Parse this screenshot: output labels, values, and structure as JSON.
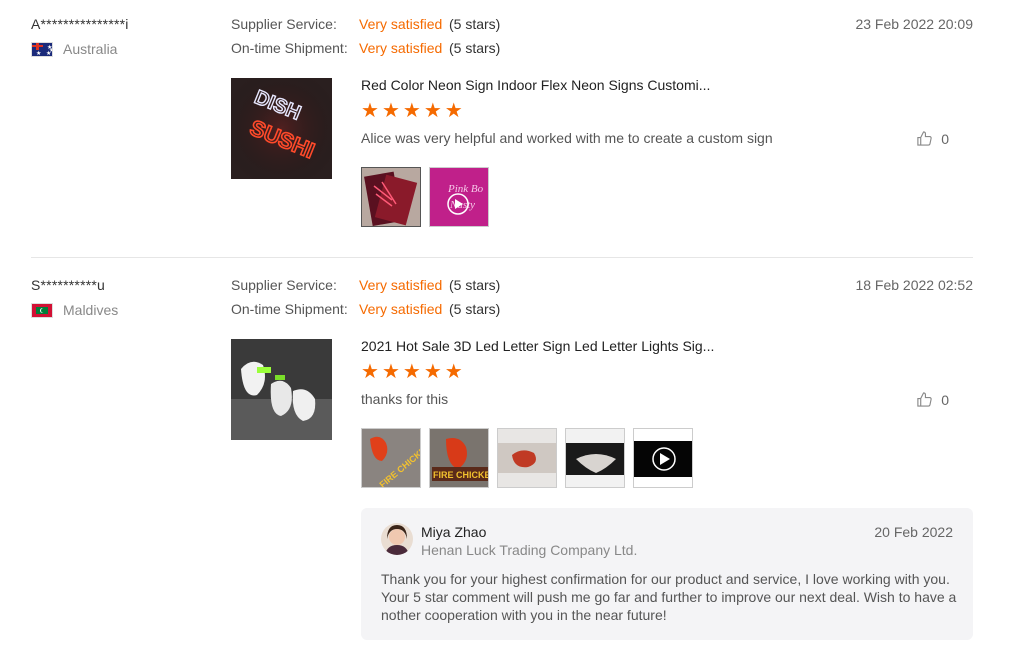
{
  "reviews": [
    {
      "buyer": "A***************i",
      "country": "Australia",
      "ratings": [
        {
          "label": "Supplier Service:",
          "value": "Very satisfied",
          "stars": "(5 stars)"
        },
        {
          "label": "On-time Shipment:",
          "value": "Very satisfied",
          "stars": "(5 stars)"
        }
      ],
      "date": "23 Feb 2022 20:09",
      "product_title": "Red Color Neon Sign Indoor Flex Neon Signs Customi...",
      "product_stars": 5,
      "comment": "Alice was very helpful and worked with me to create a custom sign",
      "likes": "0",
      "product_image_text": [
        "DISH",
        "SUSHI"
      ],
      "thumb2_text": [
        "Pink Bo",
        "Nasty"
      ]
    },
    {
      "buyer": "S**********u",
      "country": "Maldives",
      "ratings": [
        {
          "label": "Supplier Service:",
          "value": "Very satisfied",
          "stars": "(5 stars)"
        },
        {
          "label": "On-time Shipment:",
          "value": "Very satisfied",
          "stars": "(5 stars)"
        }
      ],
      "date": "18 Feb 2022 02:52",
      "product_title": "2021 Hot Sale 3D Led Letter Sign Led Letter Lights Sig...",
      "product_stars": 5,
      "comment": "thanks for this",
      "likes": "0",
      "thumb_text": [
        "FIRE CHICKEN",
        "FIRE CHICKEN"
      ],
      "reply": {
        "name": "Miya Zhao",
        "company": "Henan Luck Trading Company Ltd.",
        "date": "20 Feb 2022",
        "text": "Thank you for your highest confirmation for our product and service, I love working with you. Your 5 star comment will push me go far and further to improve our next deal. Wish to have another cooperation with you in the near future!"
      }
    }
  ],
  "colors": {
    "accent": "#f56a00",
    "divider": "#e6e6e6",
    "reply_bg": "#f4f4f6"
  }
}
